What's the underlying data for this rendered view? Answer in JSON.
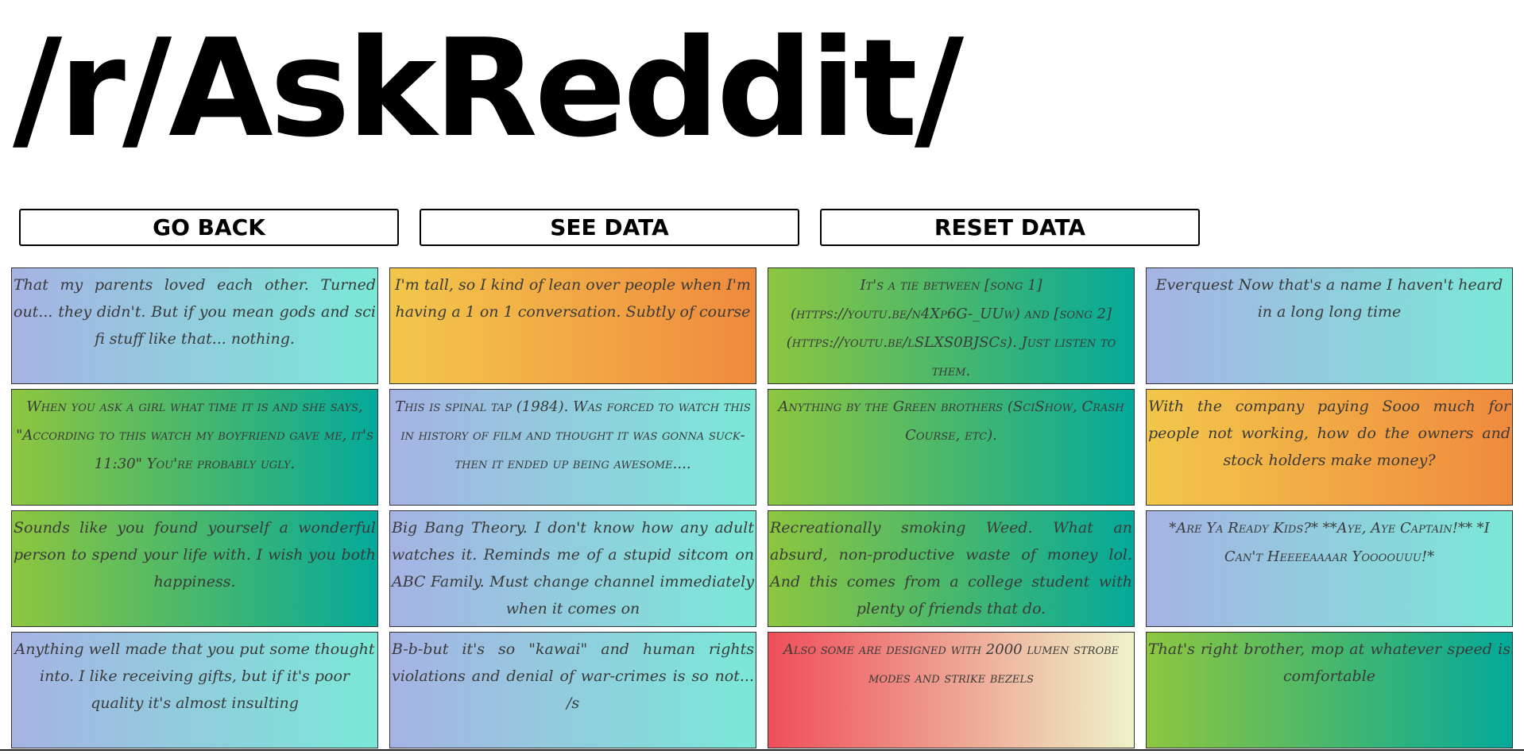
{
  "page": {
    "title": "/r/AskReddit/"
  },
  "buttons": {
    "go_back": "GO BACK",
    "see_data": "SEE DATA",
    "reset_data": "RESET DATA"
  },
  "cards": [
    {
      "text": "That my parents loved each other. Turned out... they didn't. But if you mean gods and sci fi stuff like that... nothing.",
      "gradient": "blue"
    },
    {
      "text": "I'm tall, so I kind of lean over people when I'm having a 1 on 1 conversation. Subtly of course",
      "gradient": "orange"
    },
    {
      "text": "It's a tie between [song 1](https://youtu.be/n4Xp6G-_UUw) and [song 2](https://youtu.be/lSLXS0BJSCs). Just listen to them.",
      "gradient": "green"
    },
    {
      "text": "Everquest Now that's a name I haven't heard in a long long time",
      "gradient": "blue"
    },
    {
      "text": "When you ask a girl what time it is and she says, \"According to this watch my boyfriend gave me, it's 11:30\" You're probably ugly.",
      "gradient": "green"
    },
    {
      "text": "This is spinal tap (1984). Was forced to watch this in history of film and thought it was gonna suck- then it ended up being awesome....",
      "gradient": "blue"
    },
    {
      "text": "Anything by the Green brothers (SciShow, Crash Course, etc).",
      "gradient": "green"
    },
    {
      "text": "With the company paying Sooo much for people not working, how do the owners and stock holders make money?",
      "gradient": "orange"
    },
    {
      "text": "Sounds like you found yourself a wonderful person to spend your life with. I wish you both happiness.",
      "gradient": "green"
    },
    {
      "text": "Big Bang Theory. I don't know how any adult watches it. Reminds me of a stupid sitcom on ABC Family. Must change channel immediately when it comes on",
      "gradient": "blue"
    },
    {
      "text": "Recreationally smoking Weed. What an absurd, non-productive waste of money lol. And this comes from a college student with plenty of friends that do.",
      "gradient": "green"
    },
    {
      "text": "*Are Ya Ready Kids?* **Aye, Aye Captain!** *I Can't Heeeeaaaar Yoooouuu!*",
      "gradient": "blue"
    },
    {
      "text": "Anything well made that you put some thought into. I like receiving gifts, but if it's poor quality it's almost insulting",
      "gradient": "blue"
    },
    {
      "text": "B-b-but it's so \"kawai\" and human rights violations and denial of war-crimes is so not... /s",
      "gradient": "blue"
    },
    {
      "text": "Also some are designed with 2000 lumen strobe modes and strike bezels",
      "gradient": "red"
    },
    {
      "text": "That's right brother, mop at whatever speed is comfortable",
      "gradient": "green"
    }
  ]
}
